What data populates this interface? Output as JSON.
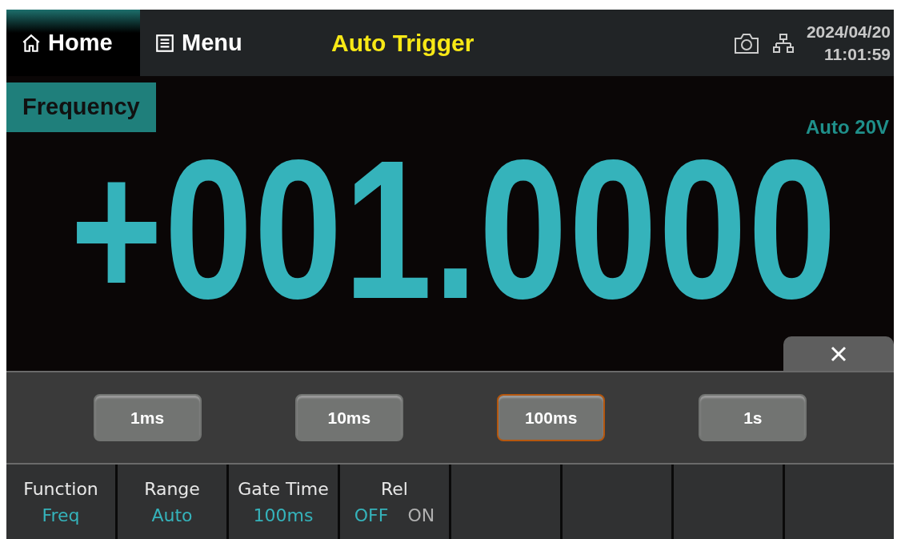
{
  "top_bar": {
    "tabs": [
      {
        "label": "Home",
        "kind": "home",
        "selected": true
      },
      {
        "label": "Menu",
        "kind": "menu",
        "selected": false
      }
    ],
    "trigger_mode": "Auto Trigger",
    "date": "2024/04/20",
    "time": "11:01:59"
  },
  "measurement": {
    "function": "Frequency",
    "range": "Auto 20V",
    "reading": "+001.0000"
  },
  "gate_popup": {
    "options": [
      {
        "label": "1ms",
        "selected": false
      },
      {
        "label": "10ms",
        "selected": false
      },
      {
        "label": "100ms",
        "selected": true
      },
      {
        "label": "1s",
        "selected": false
      }
    ]
  },
  "softkeys": [
    {
      "kind": "value",
      "title": "Function",
      "value": "Freq"
    },
    {
      "kind": "value",
      "title": "Range",
      "value": "Auto"
    },
    {
      "kind": "value",
      "title": "Gate Time",
      "value": "100ms"
    },
    {
      "kind": "toggle",
      "title": "Rel",
      "options": [
        {
          "label": "OFF",
          "selected": true
        },
        {
          "label": "ON",
          "selected": false
        }
      ]
    },
    {
      "kind": "empty"
    },
    {
      "kind": "empty"
    },
    {
      "kind": "empty"
    },
    {
      "kind": "empty"
    }
  ]
}
